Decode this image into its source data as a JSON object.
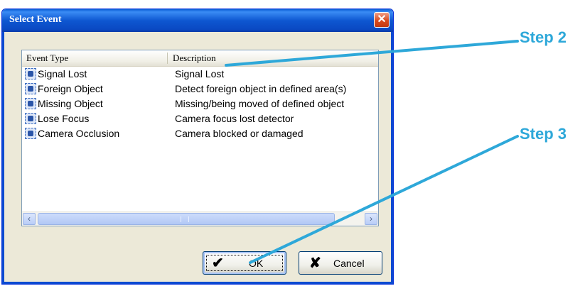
{
  "dialog": {
    "title": "Select Event",
    "close_glyph": "✕"
  },
  "list": {
    "columns": [
      "Event Type",
      "Description"
    ],
    "rows": [
      {
        "icon": "signal-lost-icon",
        "type": "Signal Lost",
        "description": "Signal Lost"
      },
      {
        "icon": "foreign-object-icon",
        "type": "Foreign Object",
        "description": "Detect foreign object in defined area(s)"
      },
      {
        "icon": "missing-object-icon",
        "type": "Missing Object",
        "description": "Missing/being moved of defined object"
      },
      {
        "icon": "lose-focus-icon",
        "type": "Lose Focus",
        "description": "Camera focus lost detector"
      },
      {
        "icon": "camera-occlusion-icon",
        "type": "Camera Occlusion",
        "description": "Camera blocked or damaged"
      }
    ]
  },
  "scrollbar": {
    "left_glyph": "‹",
    "right_glyph": "›"
  },
  "buttons": {
    "ok_glyph": "✔",
    "ok_label": "OK",
    "cancel_glyph": "✘",
    "cancel_label": "Cancel"
  },
  "annotations": {
    "step2": "Step 2",
    "step3": "Step 3",
    "color": "#2ea8d9"
  },
  "colors": {
    "titlebar": "#0a49c3",
    "dialog_bg": "#ece9d8",
    "close": "#d94a1e"
  }
}
